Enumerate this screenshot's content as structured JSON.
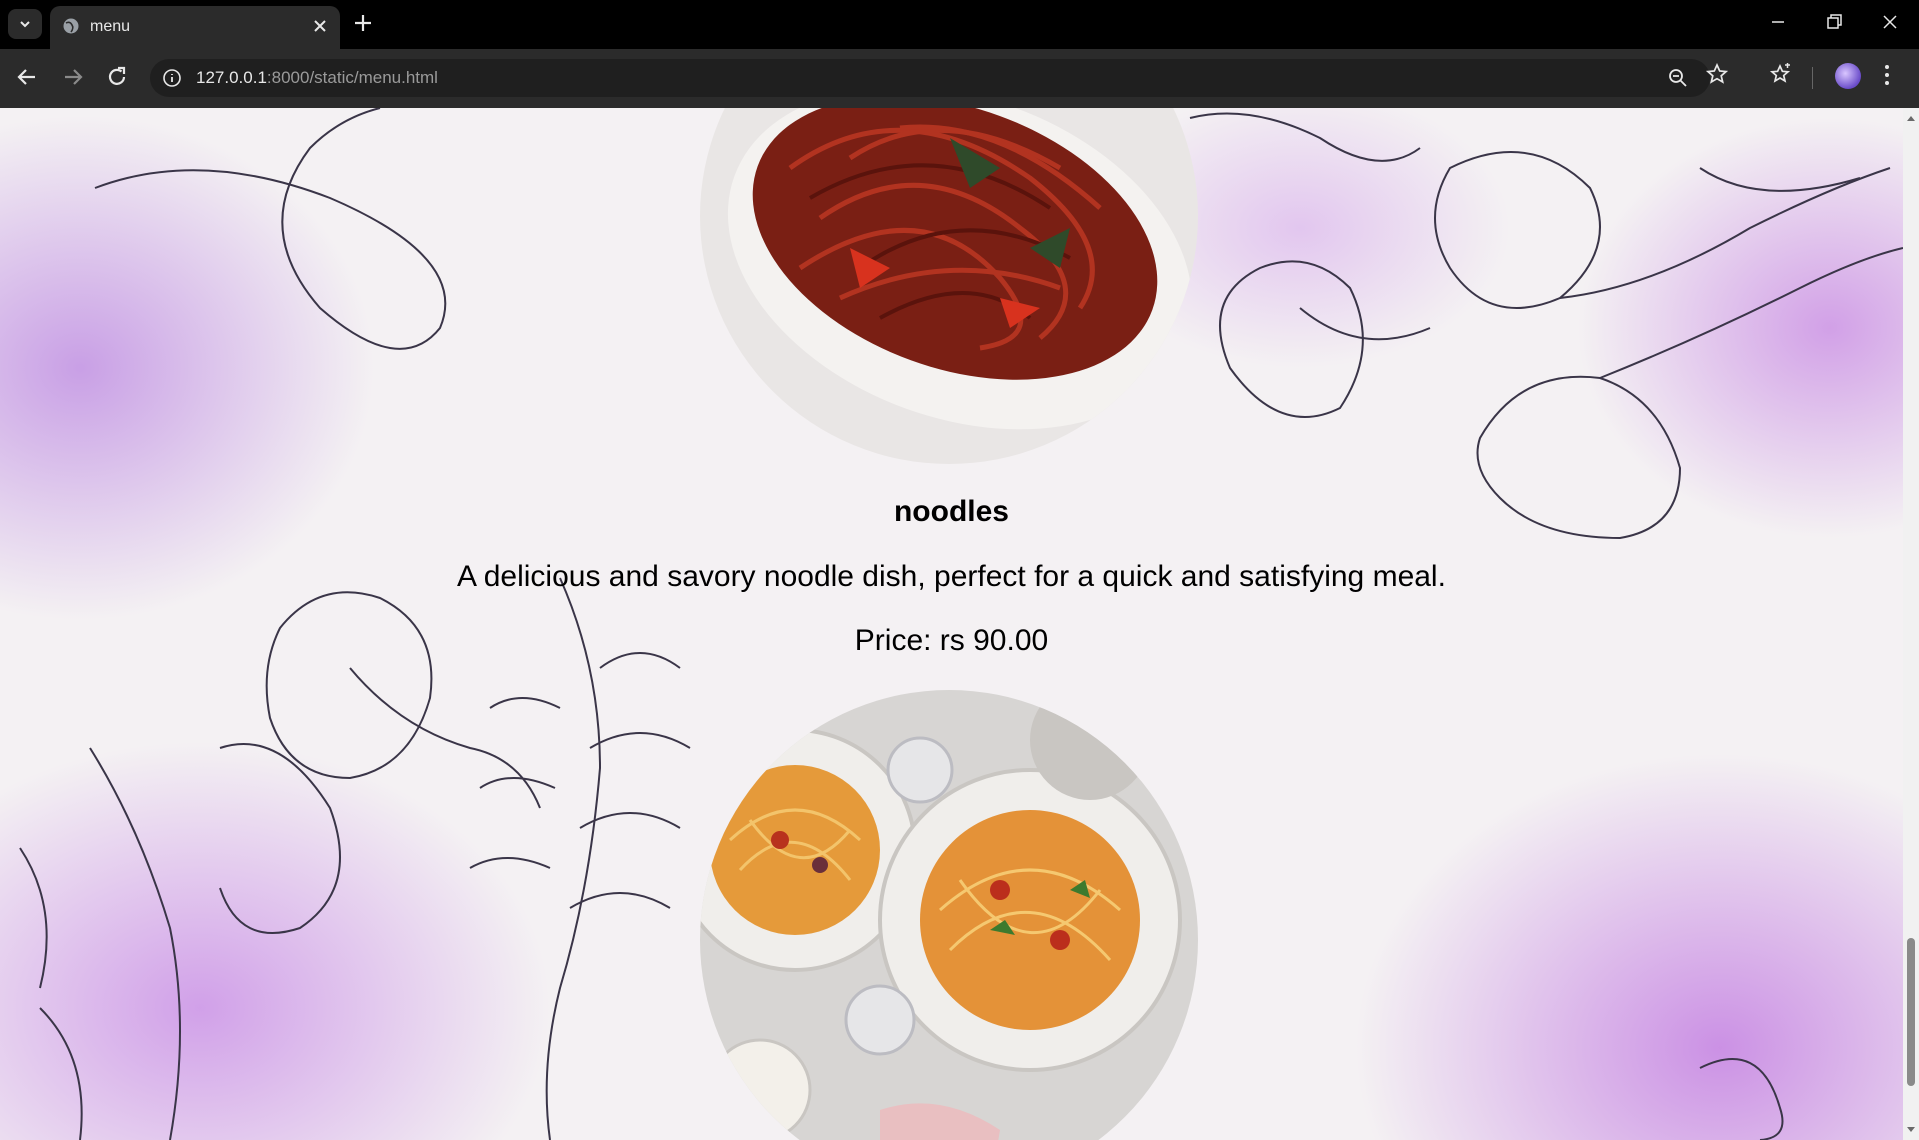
{
  "browser": {
    "tab_title": "menu",
    "url_host": "127.0.0.1",
    "url_rest": ":8000/static/menu.html"
  },
  "menu_item": {
    "name": "noodles",
    "description": "A delicious and savory noodle dish, perfect for a quick and satisfying meal.",
    "price": "Price: rs 90.00"
  },
  "icons": {
    "tab_search": "chevron-down-icon",
    "favicon": "globe-icon",
    "tab_close": "close-icon",
    "new_tab": "plus-icon",
    "back": "arrow-left-icon",
    "forward": "arrow-right-icon",
    "reload": "reload-icon",
    "site_info": "info-icon",
    "zoom": "zoom-out-icon",
    "bookmark": "star-icon",
    "bookmarks": "bookmarks-icon",
    "menu": "kebab-icon"
  }
}
